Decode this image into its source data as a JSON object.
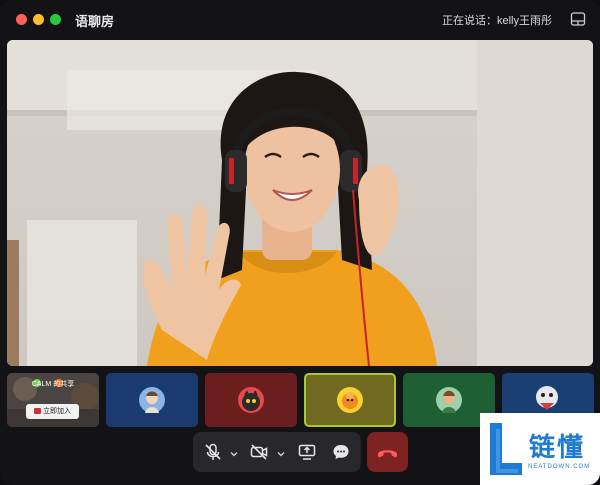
{
  "app": {
    "title": "语聊房"
  },
  "header": {
    "speaking_label": "正在说话：kelly王雨彤"
  },
  "share_card": {
    "title": "CALM 的共享",
    "join_label": "立即加入"
  },
  "watermark": {
    "brand": "链懂",
    "site": "NEATDOWN.COM"
  },
  "icons": {
    "layout": "layout-icon",
    "mic": "mic-muted-icon",
    "camera": "camera-off-icon",
    "share": "screen-share-icon",
    "chat": "chat-icon",
    "hangup": "hang-up-icon"
  },
  "colors": {
    "tile_blue": "#1b3a70",
    "tile_red": "#6c1e1e",
    "tile_olive": "#6f6a1f",
    "tile_green": "#1e5f34",
    "tile_navy": "#1a3f72",
    "hangup": "#7e2222",
    "brand": "#1f7bd1"
  }
}
